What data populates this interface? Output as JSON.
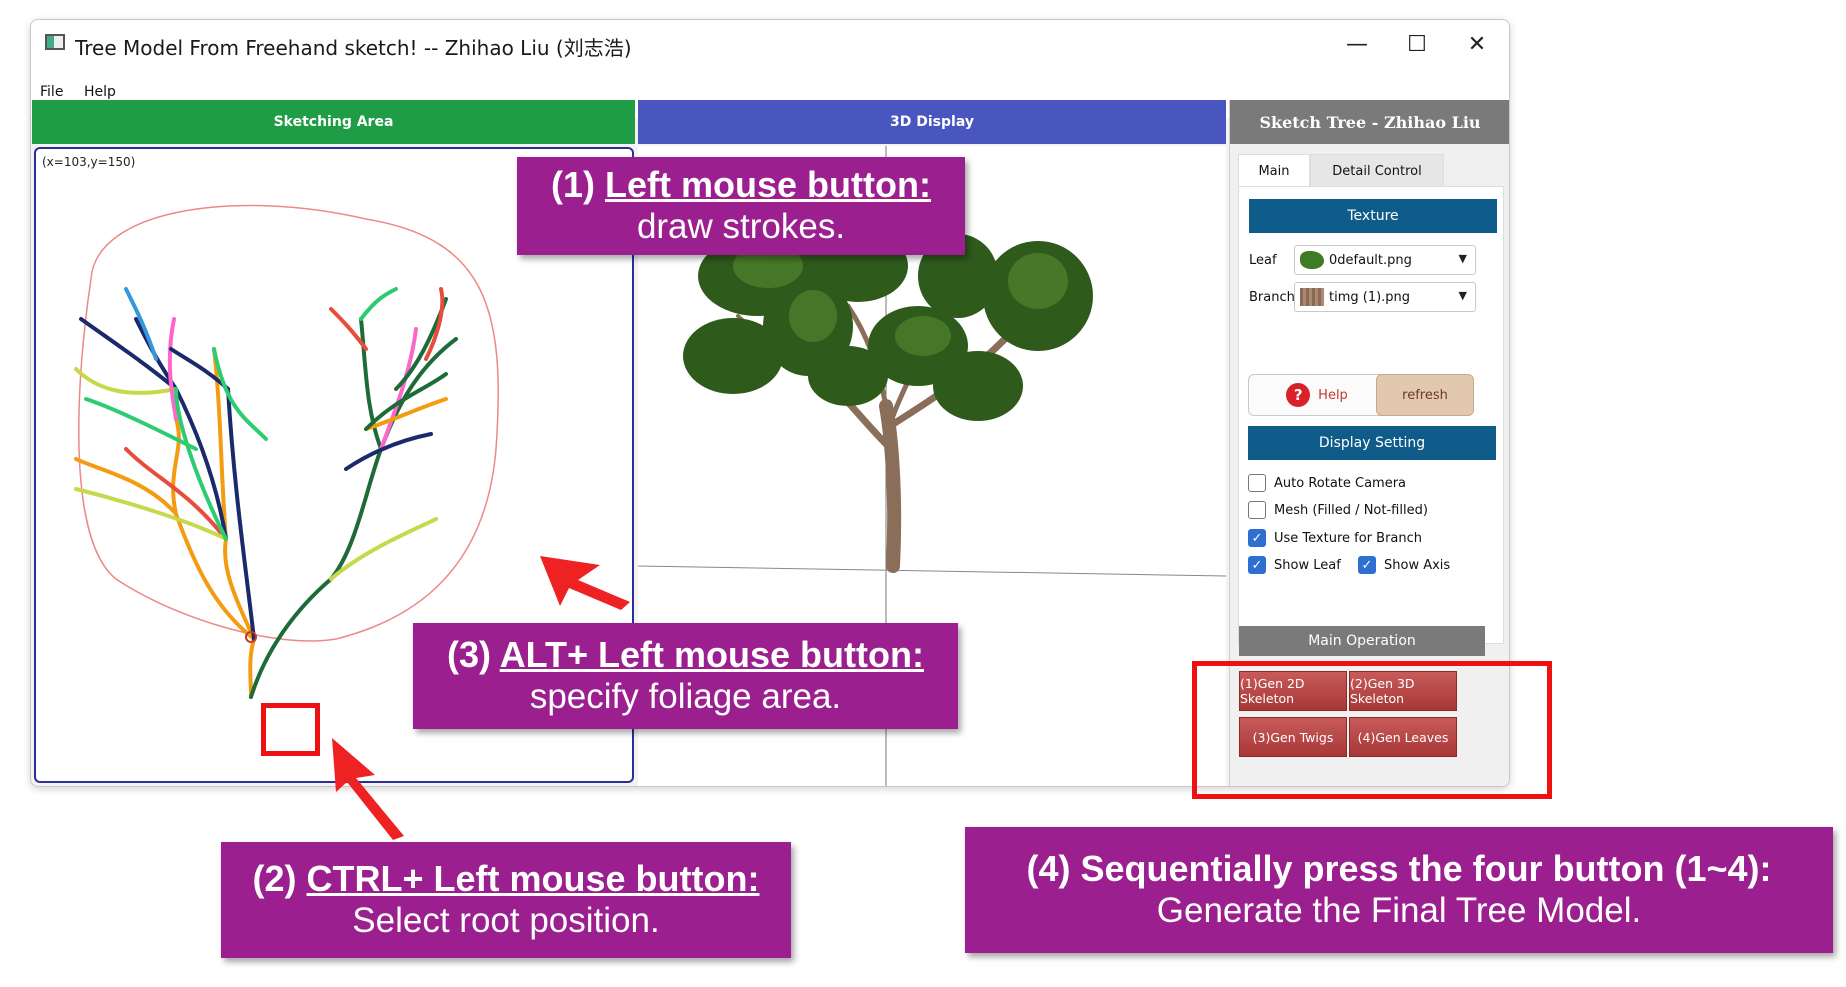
{
  "window": {
    "title": "Tree Model From Freehand sketch! -- Zhihao Liu (刘志浩)",
    "controls": {
      "minimize": "—",
      "maximize": "☐",
      "close": "✕"
    }
  },
  "menu": [
    "File",
    "Help"
  ],
  "tabs": {
    "sketch": "Sketching Area",
    "display": "3D Display"
  },
  "sketch": {
    "coord_readout": "(x=103,y=150)"
  },
  "panel": {
    "title": "Sketch Tree - Zhihao Liu",
    "tabs": [
      "Main",
      "Detail Control"
    ],
    "texture_label": "Texture",
    "leaf_label": "Leaf",
    "leaf_value": "0default.png",
    "branch_label": "Branch",
    "branch_value": "timg (1).png",
    "help_label": "Help",
    "help_glyph": "?",
    "refresh_label": "refresh",
    "display_setting_label": "Display Setting",
    "checks": {
      "auto_rotate": {
        "label": "Auto Rotate Camera",
        "checked": false
      },
      "mesh": {
        "label": "Mesh (Filled / Not-filled)",
        "checked": false
      },
      "texture_branch": {
        "label": "Use Texture for Branch",
        "checked": true
      },
      "show_leaf": {
        "label": "Show Leaf",
        "checked": true
      },
      "show_axis": {
        "label": "Show Axis",
        "checked": true
      }
    },
    "main_operation_label": "Main Operation",
    "ops": [
      "(1)Gen 2D Skeleton",
      "(2)Gen 3D Skeleton",
      "(3)Gen Twigs",
      "(4)Gen Leaves"
    ]
  },
  "callouts": {
    "c1": {
      "prefix": "(1) ",
      "title": "Left mouse button:",
      "body": "draw strokes."
    },
    "c2": {
      "prefix": "(2) ",
      "title": "CTRL+ Left mouse button:",
      "body": "Select root position."
    },
    "c3": {
      "prefix": "(3) ",
      "title": "ALT+ Left mouse button:",
      "body": "specify foliage area."
    },
    "c4": {
      "title": "(4) Sequentially press the four button (1~4):",
      "body": "Generate the Final Tree Model."
    }
  },
  "colors": {
    "sketch_tab": "#1f9c46",
    "display_tab": "#4a56c0",
    "section_bar": "#0f5b8a",
    "callout": "#9b1f8f",
    "highlight": "#ee1111",
    "op_button": "#b44646"
  }
}
